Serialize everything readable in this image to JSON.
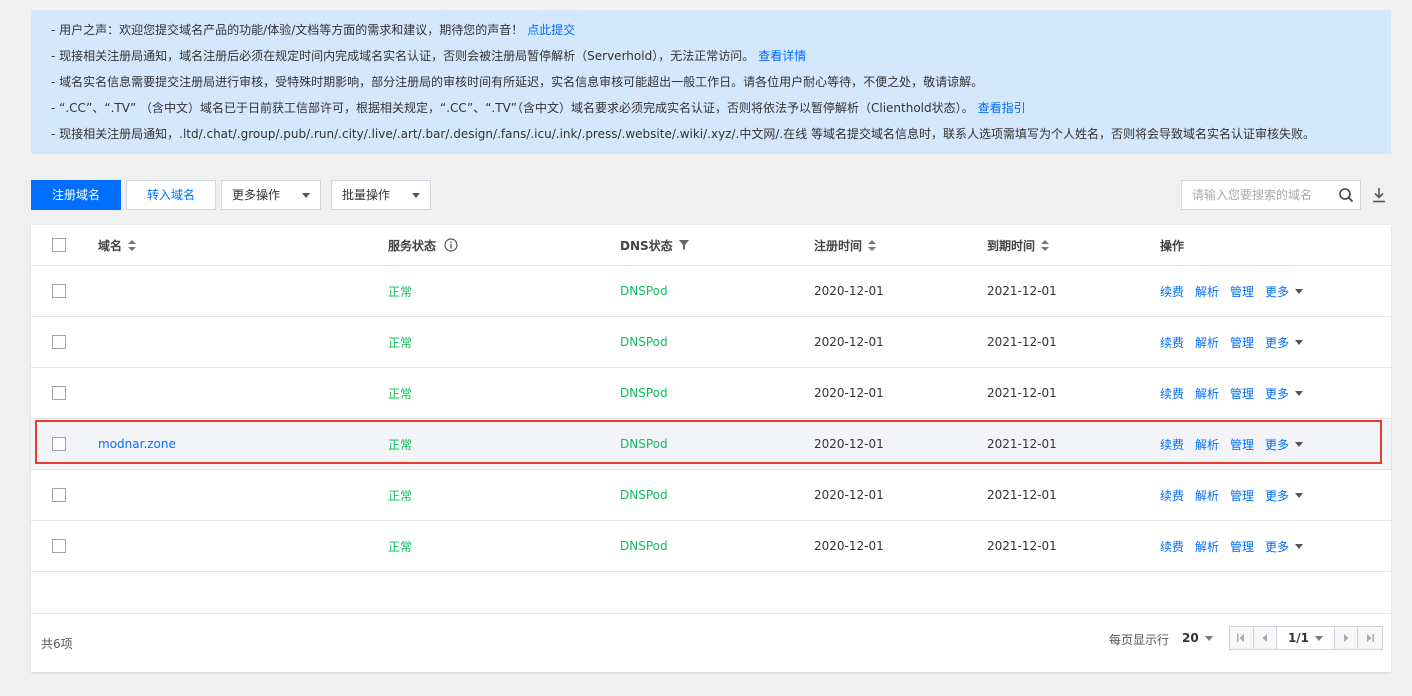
{
  "notice": {
    "lines": [
      {
        "text": "- 用户之声：欢迎您提交域名产品的功能/体验/文档等方面的需求和建议，期待您的声音！",
        "link": "点此提交"
      },
      {
        "text": "- 现接相关注册局通知，域名注册后必须在规定时间内完成域名实名认证，否则会被注册局暂停解析（Serverhold），无法正常访问。",
        "link": "查看详情"
      },
      {
        "text": "- 域名实名信息需要提交注册局进行审核，受特殊时期影响，部分注册局的审核时间有所延迟，实名信息审核可能超出一般工作日。请各位用户耐心等待，不便之处，敬请谅解。",
        "link": ""
      },
      {
        "text": "- “.CC”、“.TV” （含中文）域名已于日前获工信部许可，根据相关规定，“.CC”、“.TV”（含中文）域名要求必须完成实名认证，否则将依法予以暂停解析（Clienthold状态）。",
        "link": "查看指引"
      },
      {
        "text": "- 现接相关注册局通知，.ltd/.chat/.group/.pub/.run/.city/.live/.art/.bar/.design/.fans/.icu/.ink/.press/.website/.wiki/.xyz/.中文网/.在线 等域名提交域名信息时，联系人选项需填写为个人姓名，否则将会导致域名实名认证审核失败。",
        "link": ""
      }
    ]
  },
  "toolbar": {
    "register_label": "注册域名",
    "transfer_label": "转入域名",
    "more_ops_label": "更多操作",
    "batch_ops_label": "批量操作",
    "search_placeholder": "请输入您要搜索的域名"
  },
  "table": {
    "headers": {
      "name": "域名",
      "status": "服务状态",
      "dns": "DNS状态",
      "registered": "注册时间",
      "expires": "到期时间",
      "ops": "操作"
    },
    "rows": [
      {
        "name": "",
        "status": "正常",
        "dns": "DNSPod",
        "registered": "2020-12-01",
        "expires": "2021-12-01"
      },
      {
        "name": "",
        "status": "正常",
        "dns": "DNSPod",
        "registered": "2020-12-01",
        "expires": "2021-12-01"
      },
      {
        "name": "",
        "status": "正常",
        "dns": "DNSPod",
        "registered": "2020-12-01",
        "expires": "2021-12-01"
      },
      {
        "name": "modnar.zone",
        "status": "正常",
        "dns": "DNSPod",
        "registered": "2020-12-01",
        "expires": "2021-12-01"
      },
      {
        "name": "",
        "status": "正常",
        "dns": "DNSPod",
        "registered": "2020-12-01",
        "expires": "2021-12-01"
      },
      {
        "name": "",
        "status": "正常",
        "dns": "DNSPod",
        "registered": "2020-12-01",
        "expires": "2021-12-01"
      }
    ],
    "row_ops": {
      "renew": "续费",
      "resolve": "解析",
      "manage": "管理",
      "more": "更多"
    }
  },
  "footer": {
    "total": "共6项",
    "per_page_label": "每页显示行",
    "per_page_value": "20",
    "page_indicator": "1/1"
  },
  "colors": {
    "accent": "#006eff",
    "status_ok": "#0abf5b",
    "notice_bg": "#d5e7fd",
    "highlight": "#e53e30"
  }
}
